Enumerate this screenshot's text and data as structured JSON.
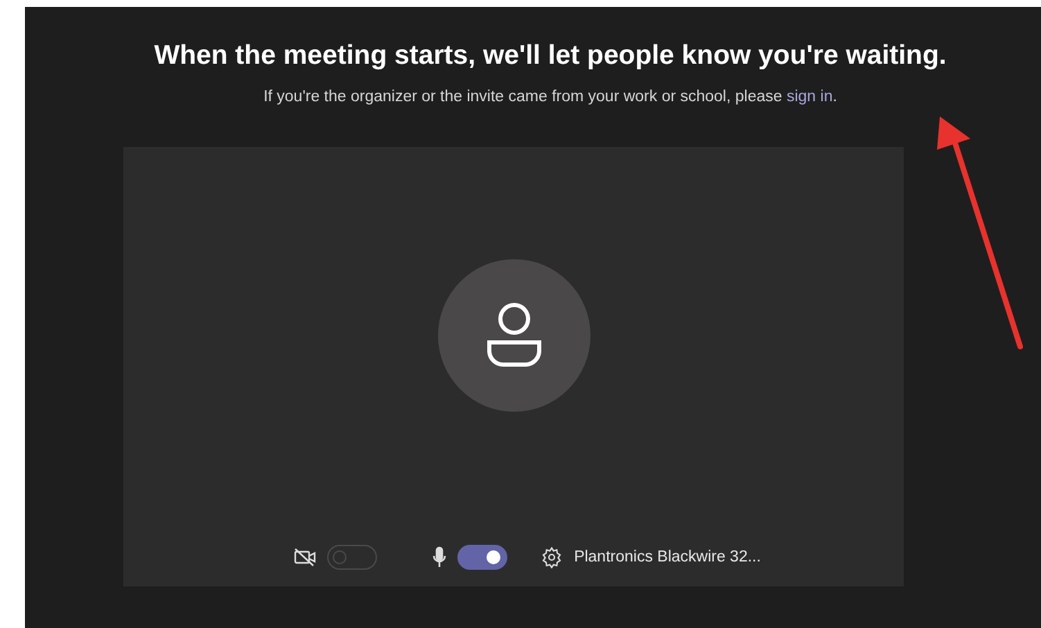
{
  "heading": "When the meeting starts, we'll let people know you're waiting.",
  "subtitle": {
    "text": "If you're the organizer or the invite came from your work or school, please ",
    "link": "sign in",
    "end": "."
  },
  "preview": {
    "camera": {
      "on": false
    },
    "microphone": {
      "on": true
    },
    "device": "Plantronics Blackwire 32..."
  }
}
